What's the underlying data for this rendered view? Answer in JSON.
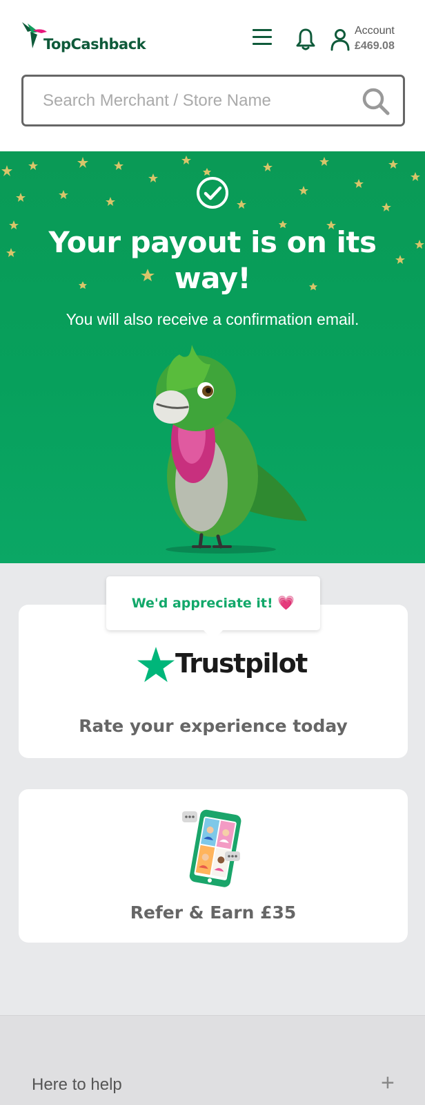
{
  "header": {
    "logo_text": "TopCashback",
    "account_label": "Account",
    "account_balance": "£469.08",
    "icons": [
      "hummingbird-logo",
      "menu-icon",
      "bell-icon",
      "user-icon"
    ]
  },
  "search": {
    "placeholder": "Search Merchant / Store Name",
    "value": ""
  },
  "hero": {
    "title": "Your payout is on its way!",
    "subtitle": "You will also receive a confirmation email."
  },
  "trustpilot": {
    "tooltip": "We'd appreciate it!",
    "heart": "💗",
    "brand": "Trustpilot",
    "cta": "Rate your experience today"
  },
  "refer": {
    "cta": "Refer & Earn £35"
  },
  "footer": {
    "help_label": "Here to help",
    "expand_symbol": "+"
  },
  "colors": {
    "brand_green": "#0a9a56",
    "logo_green": "#0f5a3a",
    "tooltip_green": "#12a86a",
    "trustpilot_green": "#00b67a",
    "heart_pink": "#f0609c"
  }
}
